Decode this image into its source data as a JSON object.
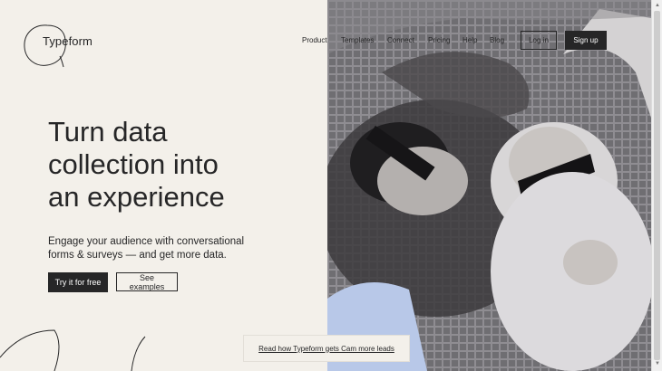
{
  "brand": {
    "name": "Typeform"
  },
  "nav": {
    "links": [
      "Product",
      "Templates",
      "Connect",
      "Pricing",
      "Help",
      "Blog"
    ],
    "login_label": "Log in",
    "signup_label": "Sign up"
  },
  "hero": {
    "title_lines": [
      "Turn data",
      "collection into",
      "an experience"
    ],
    "subtitle_lines": [
      "Engage your audience with conversational",
      "forms & surveys — and get more data."
    ],
    "cta_primary": "Try it for free",
    "cta_secondary": "See examples"
  },
  "banner": {
    "link_text": "Read how Typeform gets Cam more leads"
  },
  "colors": {
    "background": "#f3f0ea",
    "text": "#262627",
    "button_dark": "#262627",
    "accent_blob": "#b8c8e8"
  },
  "icons": {
    "scroll_up": "▲",
    "scroll_down": "▼"
  }
}
